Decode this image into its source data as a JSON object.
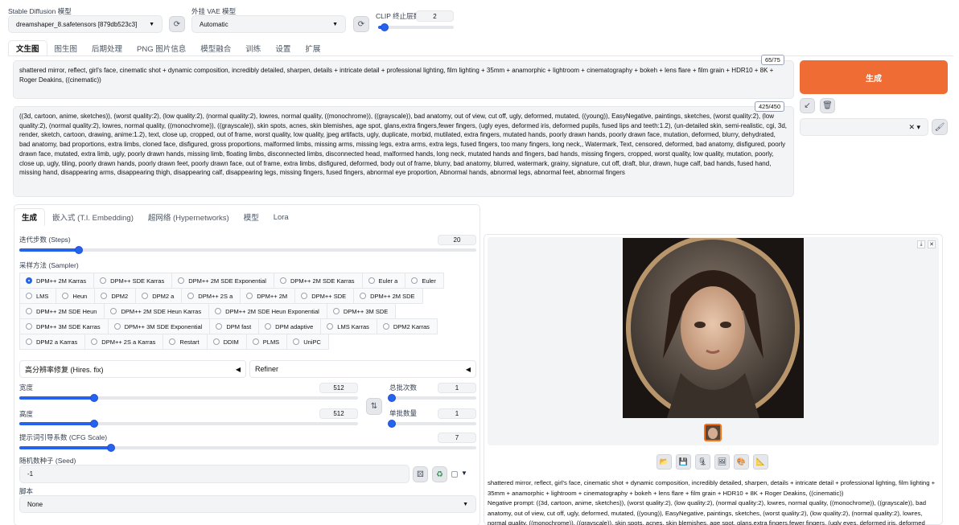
{
  "header": {
    "sd_model_label": "Stable Diffusion 模型",
    "sd_model_value": "dreamshaper_8.safetensors [879db523c3]",
    "vae_label": "外挂 VAE 模型",
    "vae_value": "Automatic",
    "clip_label": "CLIP 终止层数",
    "clip_value": "2",
    "clip_fraction": 0.083
  },
  "main_tabs": [
    "文生图",
    "图生图",
    "后期处理",
    "PNG 图片信息",
    "模型融合",
    "训练",
    "设置",
    "扩展"
  ],
  "prompt": {
    "positive": "shattered mirror, reflect, girl's face, cinematic shot + dynamic composition, incredibly detailed, sharpen, details + intricate detail + professional lighting, film lighting + 35mm + anamorphic + lightroom + cinematography + bokeh + lens flare + film grain + HDR10 + 8K + Roger Deakins, ((cinematic))",
    "positive_counter": "65/75",
    "negative": " ((3d, cartoon, anime, sketches)), (worst quality:2), (low quality:2), (normal quality:2), lowres, normal quality, ((monochrome)), ((grayscale)), bad anatomy, out of view, cut off, ugly, deformed, mutated, ((young)), EasyNegative, paintings, sketches, (worst quality:2), (low quality:2), (normal quality:2), lowres, normal quality, ((monochrome)), ((grayscale)), skin spots, acnes, skin blemishes, age spot, glans,extra fingers,fewer fingers, (ugly eyes, deformed iris, deformed pupils, fused lips and teeth:1.2), (un-detailed skin, semi-realistic, cgi, 3d, render, sketch, cartoon, drawing, anime:1.2), text, close up, cropped, out of frame, worst quality, low quality, jpeg artifacts, ugly, duplicate, morbid, mutilated, extra fingers, mutated hands, poorly drawn hands, poorly drawn face, mutation, deformed, blurry, dehydrated, bad anatomy, bad proportions, extra limbs, cloned face, disfigured, gross proportions, malformed limbs, missing arms, missing legs, extra arms, extra legs, fused fingers, too many fingers, long neck,, Watermark, Text, censored, deformed, bad anatomy, disfigured, poorly drawn face, mutated, extra limb, ugly, poorly drawn hands, missing limb, floating limbs, disconnected limbs, disconnected head, malformed hands, long neck, mutated hands and fingers, bad hands, missing fingers, cropped, worst quality, low quality, mutation, poorly, close up, ugly, tiling, poorly drawn hands, poorly drawn feet, poorly drawn face, out of frame, extra limbs, disfigured, deformed, body out of frame, blurry, bad anatomy, blurred, watermark, grainy, signature, cut off, draft, blur, drawn, huge calf, bad hands, fused hand, missing hand, disappearing arms, disappearing thigh, disappearing calf, disappearing legs, missing fingers, fused fingers, abnormal eye proportion, Abnormal hands, abnormal legs, abnormal feet, abnormal fingers",
    "negative_counter": "425/450"
  },
  "generate_label": "生成",
  "settings_tabs": [
    "生成",
    "嵌入式 (T.I. Embedding)",
    "超网络 (Hypernetworks)",
    "模型",
    "Lora"
  ],
  "steps": {
    "label": "迭代步数 (Steps)",
    "value": "20",
    "fraction": 0.13
  },
  "sampler": {
    "label": "采样方法 (Sampler)",
    "options": [
      "DPM++ 2M Karras",
      "DPM++ SDE Karras",
      "DPM++ 2M SDE Exponential",
      "DPM++ 2M SDE Karras",
      "Euler a",
      "Euler",
      "LMS",
      "Heun",
      "DPM2",
      "DPM2 a",
      "DPM++ 2S a",
      "DPM++ 2M",
      "DPM++ SDE",
      "DPM++ 2M SDE",
      "DPM++ 2M SDE Heun",
      "DPM++ 2M SDE Heun Karras",
      "DPM++ 2M SDE Heun Exponential",
      "DPM++ 3M SDE",
      "DPM++ 3M SDE Karras",
      "DPM++ 3M SDE Exponential",
      "DPM fast",
      "DPM adaptive",
      "LMS Karras",
      "DPM2 Karras",
      "DPM2 a Karras",
      "DPM++ 2S a Karras",
      "Restart",
      "DDIM",
      "PLMS",
      "UniPC"
    ],
    "selected": "DPM++ 2M Karras"
  },
  "hires_label": "高分辨率修复 (Hires. fix)",
  "refiner_label": "Refiner",
  "width": {
    "label": "宽度",
    "value": "512",
    "fraction": 0.22
  },
  "height": {
    "label": "高度",
    "value": "512",
    "fraction": 0.22
  },
  "batch_count": {
    "label": "总批次数",
    "value": "1",
    "fraction": 0.0
  },
  "batch_size": {
    "label": "单批数量",
    "value": "1",
    "fraction": 0.0
  },
  "cfg": {
    "label": "提示词引导系数 (CFG Scale)",
    "value": "7",
    "fraction": 0.2
  },
  "seed": {
    "label": "随机数种子 (Seed)",
    "value": "-1"
  },
  "script": {
    "label": "脚本",
    "value": "None"
  },
  "output_info": {
    "prompt": "shattered mirror, reflect, girl's face, cinematic shot + dynamic composition, incredibly detailed, sharpen, details + intricate detail + professional lighting, film lighting + 35mm + anamorphic + lightroom + cinematography + bokeh + lens flare + film grain + HDR10 + 8K + Roger Deakins, ((cinematic))",
    "negative_prefix": "Negative prompt: ((3d, cartoon, anime, sketches)), (worst quality:2), (low quality:2), (normal quality:2), lowres, normal quality, ((monochrome)), ((grayscale)), bad anatomy, out of view, cut off, ugly, deformed, mutated, ((young)), EasyNegative, paintings, sketches, (worst quality:2), (low quality:2), (normal quality:2), lowres, normal quality, ((monochrome)), ((grayscale)), skin spots, acnes, skin blemishes, age spot, glans,extra fingers,fewer fingers, (ugly eyes, deformed iris, deformed pupils, fused"
  },
  "colors": {
    "accent": "#2563eb",
    "generate": "#ef6c35"
  }
}
